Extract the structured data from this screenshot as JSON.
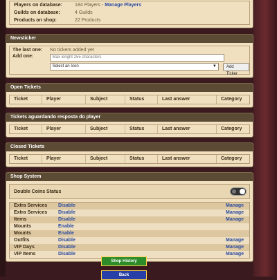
{
  "stats": [
    {
      "label": "Players on database:",
      "value": "184 Players",
      "sep": " - ",
      "link": "Manage Players"
    },
    {
      "label": "Guilds on database:",
      "value": "4 Guilds",
      "sep": "",
      "link": ""
    },
    {
      "label": "Products on shop:",
      "value": "22 Products",
      "sep": "",
      "link": ""
    }
  ],
  "newsticker": {
    "title": "Newsticker",
    "last_one_label": "The last one:",
    "last_one_value": "No tickers added yet",
    "add_one_label": "Add one:",
    "text_placeholder": "Max lenght 255 characters",
    "icon_select": "Select an Icon",
    "add_button": "Add Ticker"
  },
  "ticket_columns": [
    "Ticket",
    "Player",
    "Subject",
    "Status",
    "Last answer",
    "Category"
  ],
  "ticket_sections": [
    {
      "title": "Open Tickets"
    },
    {
      "title": "Tickets aguardando resposta do player"
    },
    {
      "title": "Closed Tickets"
    }
  ],
  "shop": {
    "title": "Shop System",
    "double_coins_label": "Double Coins Status",
    "services": [
      {
        "name": "Extra Services",
        "action": "Disable",
        "manage": "Manage"
      },
      {
        "name": "Extra Services",
        "action": "Disable",
        "manage": "Manage"
      },
      {
        "name": "Items",
        "action": "Disable",
        "manage": "Manage"
      },
      {
        "name": "Mounts",
        "action": "Enable",
        "manage": ""
      },
      {
        "name": "Mounts",
        "action": "Enable",
        "manage": ""
      },
      {
        "name": "Outfits",
        "action": "Disable",
        "manage": "Manage"
      },
      {
        "name": "VIP Days",
        "action": "Disable",
        "manage": "Manage"
      },
      {
        "name": "VIP Items",
        "action": "Disable",
        "manage": "Manage"
      }
    ]
  },
  "buttons": {
    "history": "Shop History",
    "back": "Back"
  },
  "colors": {
    "header": "#5b4a34",
    "panel": "#f1e0c0",
    "link": "#2a4ba0",
    "history_btn": "#2d8b2a",
    "back_btn": "#2740a8"
  }
}
